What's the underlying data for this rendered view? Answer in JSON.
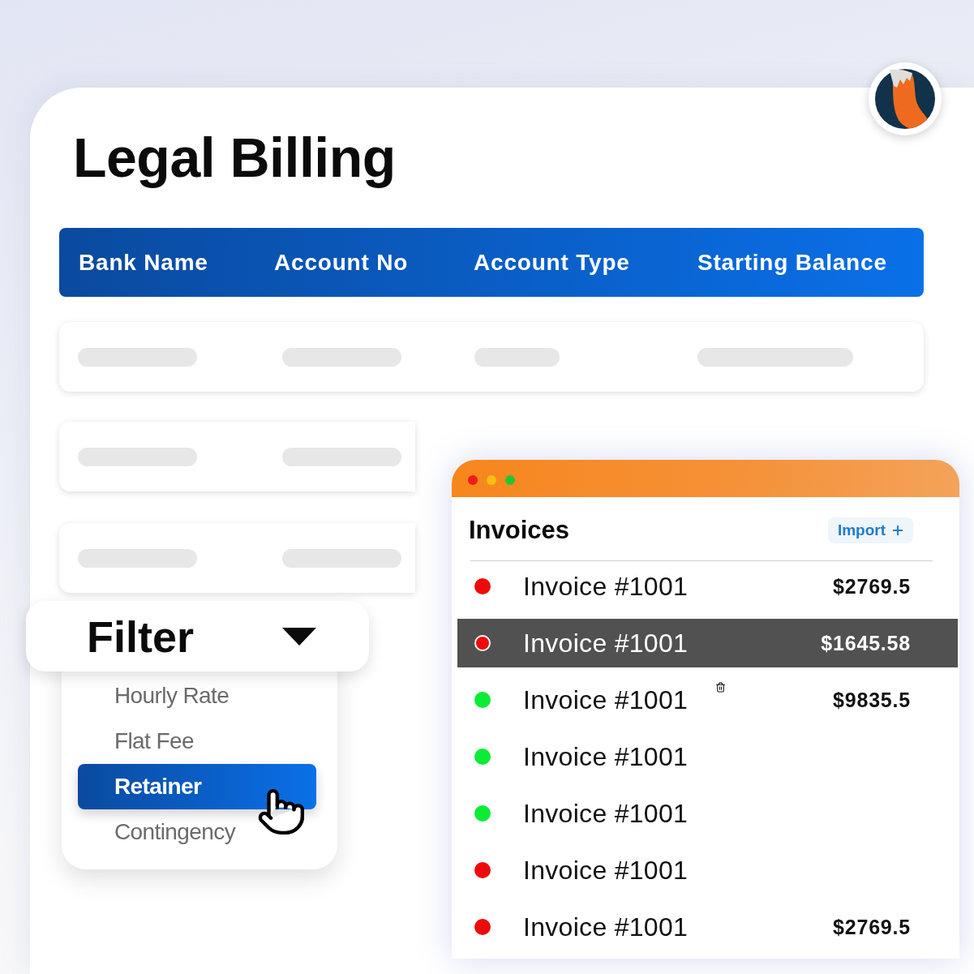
{
  "title": "Legal Billing",
  "table": {
    "columns": [
      "Bank Name",
      "Account No",
      "Account Type",
      "Starting Balance"
    ]
  },
  "filter": {
    "label": "Filter",
    "expanded": true,
    "options": [
      {
        "label": "Hourly Rate",
        "selected": false
      },
      {
        "label": "Flat Fee",
        "selected": false
      },
      {
        "label": "Retainer",
        "selected": true
      },
      {
        "label": "Contingency",
        "selected": false
      }
    ]
  },
  "invoices": {
    "title": "Invoices",
    "import_button": "Import",
    "rows": [
      {
        "name": "Invoice #1001",
        "amount": "$2769.5",
        "color": "#ee0a0a",
        "selected": false,
        "delete_icon": false
      },
      {
        "name": "Invoice #1001",
        "amount": "$1645.58",
        "color": "#ee0a0a",
        "selected": true,
        "delete_icon": false
      },
      {
        "name": "Invoice #1001",
        "amount": "$9835.5",
        "color": "#0bec34",
        "selected": false,
        "delete_icon": true
      },
      {
        "name": "Invoice #1001",
        "color": "#0bec34",
        "selected": false,
        "delete_icon": false
      },
      {
        "name": "Invoice #1001",
        "color": "#0bec34",
        "selected": false,
        "delete_icon": false
      },
      {
        "name": "Invoice #1001",
        "color": "#ee0a0a",
        "selected": false,
        "delete_icon": false
      },
      {
        "name": "Invoice #1001",
        "amount": "$2769.5",
        "color": "#ee0a0a",
        "selected": false,
        "delete_icon": false
      }
    ]
  }
}
